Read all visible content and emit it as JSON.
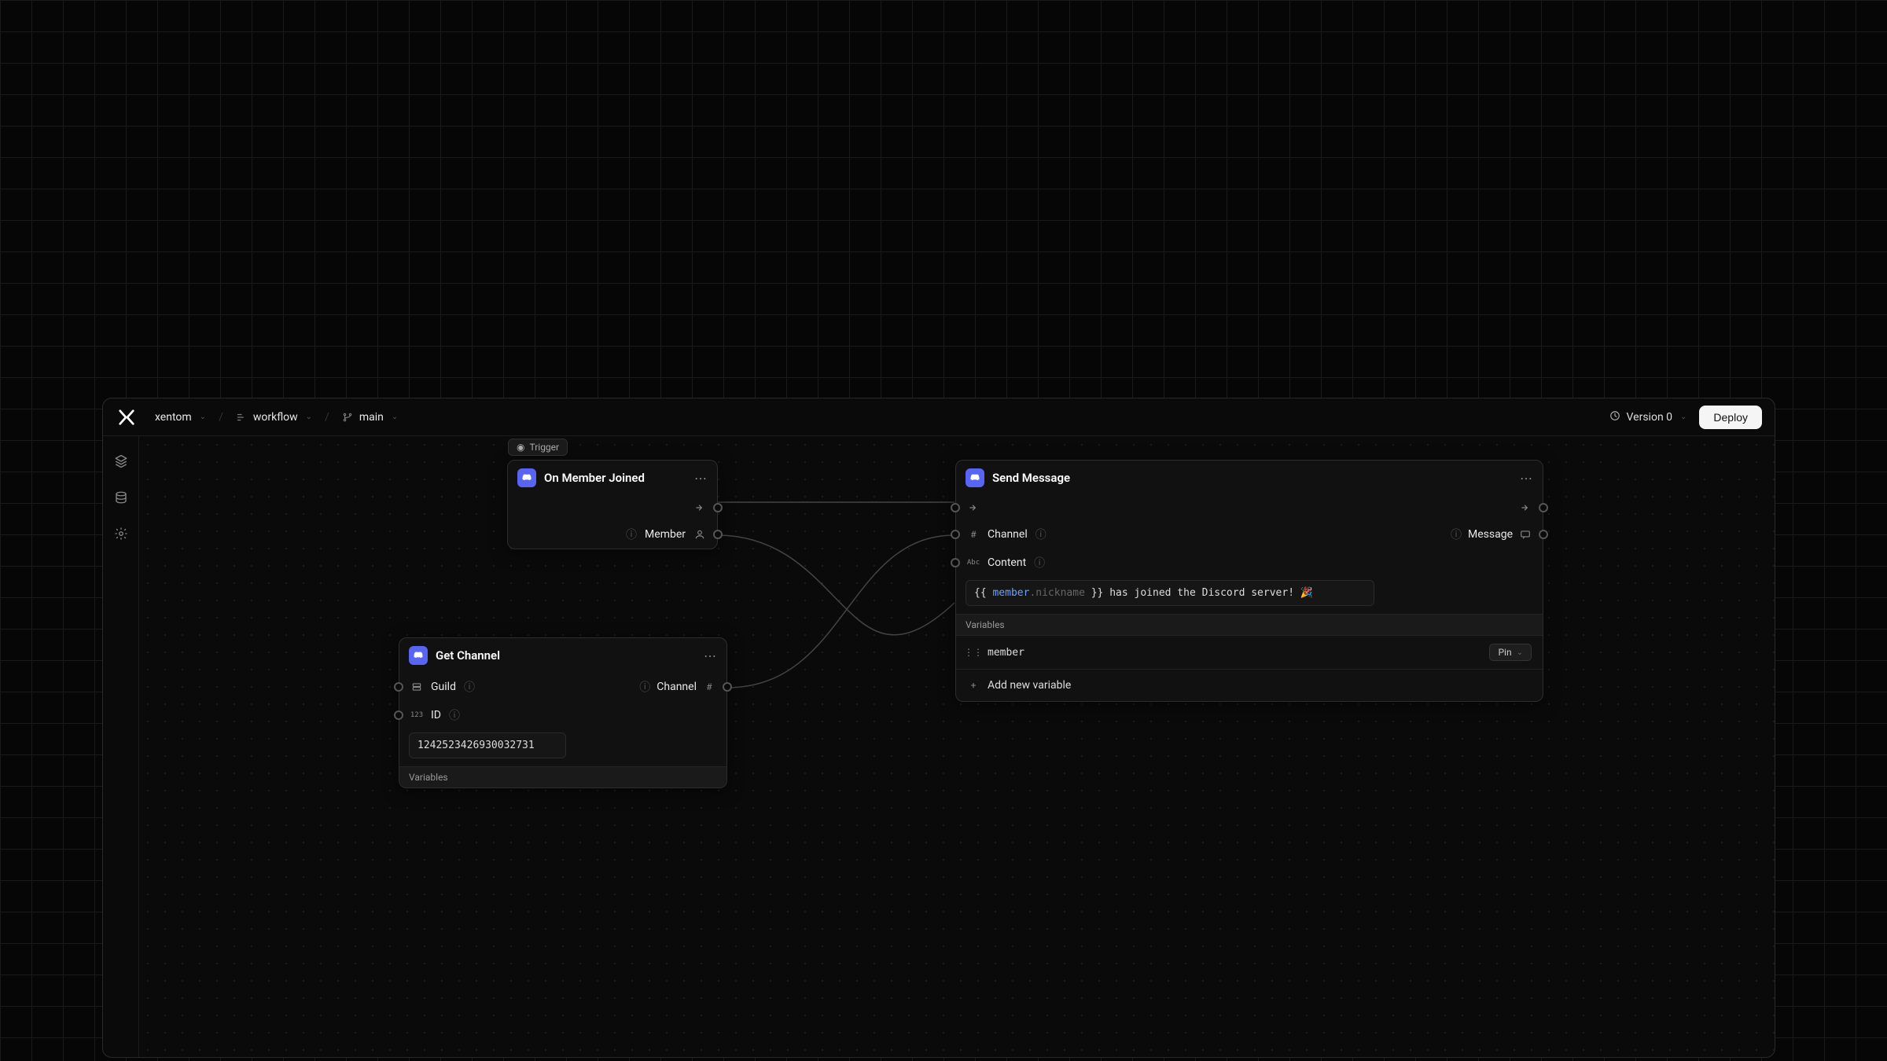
{
  "breadcrumb": {
    "org": "xentom",
    "project": "workflow",
    "branch": "main"
  },
  "topbar": {
    "version_label": "Version 0",
    "deploy_label": "Deploy"
  },
  "nodes": {
    "on_member_joined": {
      "tag": "Trigger",
      "title": "On Member Joined",
      "outputs": {
        "member": "Member"
      }
    },
    "get_channel": {
      "title": "Get Channel",
      "inputs": {
        "guild": "Guild",
        "id_label": "ID",
        "id_value": "1242523426930032731"
      },
      "outputs": {
        "channel": "Channel"
      },
      "variables_label": "Variables"
    },
    "send_message": {
      "title": "Send Message",
      "inputs": {
        "channel": "Channel",
        "content_label": "Content",
        "content_template": {
          "open": "{{ ",
          "var": "member",
          "dot": ".",
          "prop": "nickname",
          "close": " }}",
          "tail": " has joined the Discord server! 🎉"
        }
      },
      "outputs": {
        "message": "Message"
      },
      "variables_label": "Variables",
      "variables": [
        {
          "name": "member",
          "pin_label": "Pin"
        }
      ],
      "add_variable_label": "Add new variable"
    }
  }
}
